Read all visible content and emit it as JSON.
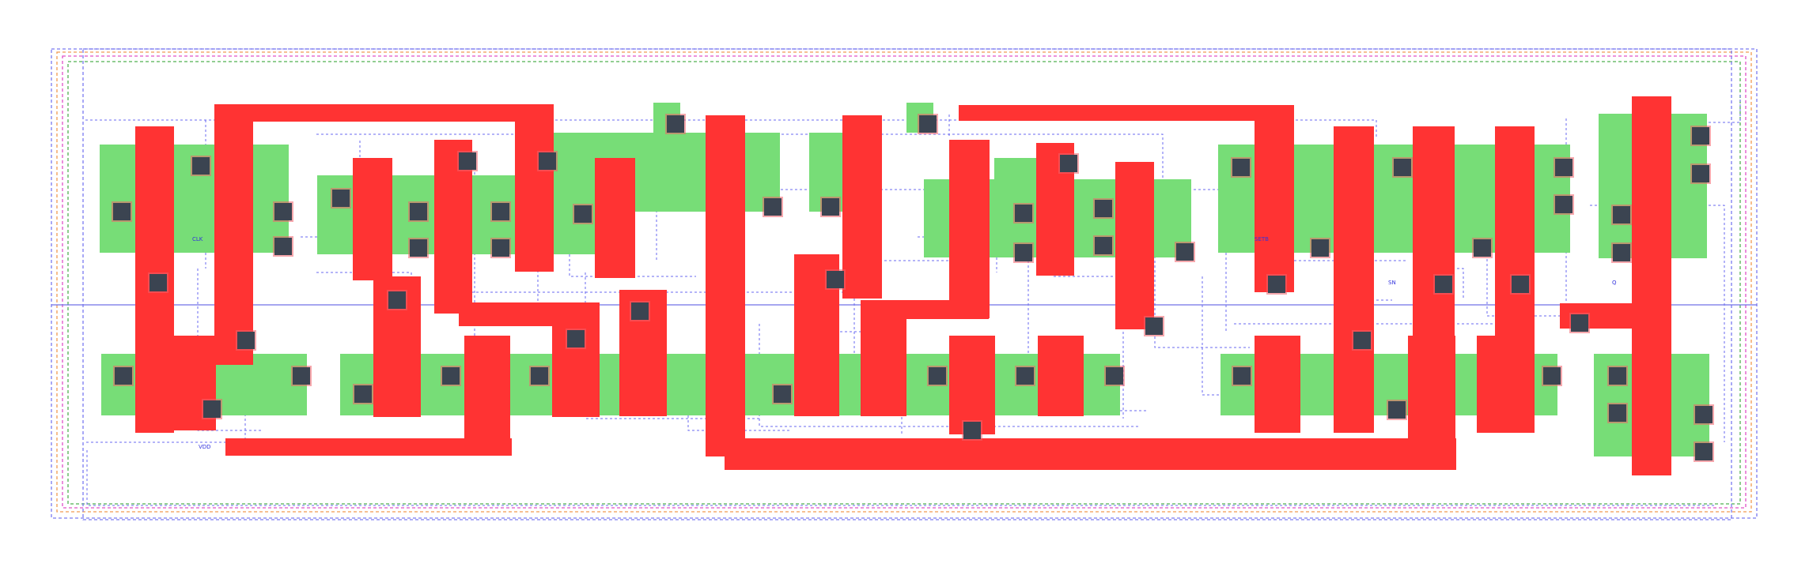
{
  "colors": {
    "background": "#ffffff",
    "diffusion": "#77dd77",
    "poly": "#ff3333",
    "contact": "#3b4451",
    "contact_border": "#f0606a",
    "route_blue": "#5a5aee",
    "boundary_orange": "#f09a50",
    "boundary_magenta": "#e050c8",
    "boundary_green": "#50b050",
    "label": "#3333dd"
  },
  "labels": {
    "clk": "CLK",
    "vdd": "VDD",
    "setb": "SETB",
    "sn": "SN",
    "q": "Q"
  }
}
